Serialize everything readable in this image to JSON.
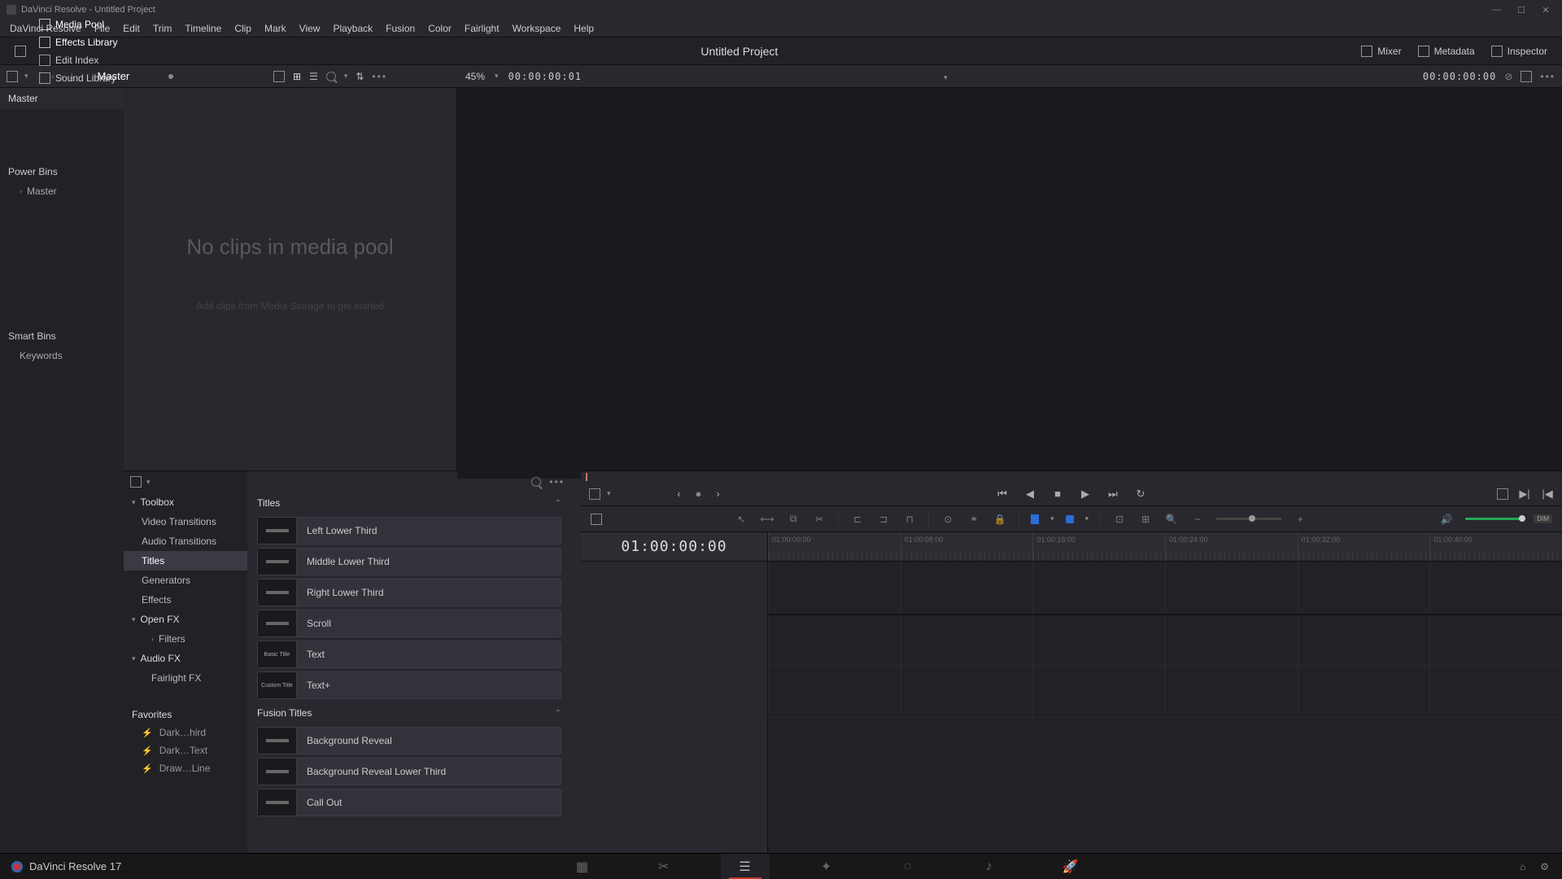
{
  "window": {
    "title": "DaVinci Resolve - Untitled Project"
  },
  "menu": [
    "DaVinci Resolve",
    "File",
    "Edit",
    "Trim",
    "Timeline",
    "Clip",
    "Mark",
    "View",
    "Playback",
    "Fusion",
    "Color",
    "Fairlight",
    "Workspace",
    "Help"
  ],
  "toolbar": {
    "left": [
      {
        "id": "media-pool",
        "label": "Media Pool"
      },
      {
        "id": "effects-library",
        "label": "Effects Library"
      },
      {
        "id": "edit-index",
        "label": "Edit Index"
      },
      {
        "id": "sound-library",
        "label": "Sound Library"
      }
    ],
    "title": "Untitled Project",
    "right": [
      {
        "id": "mixer",
        "label": "Mixer"
      },
      {
        "id": "metadata",
        "label": "Metadata"
      },
      {
        "id": "inspector",
        "label": "Inspector"
      }
    ]
  },
  "subbar": {
    "bin": "Master",
    "zoom": "45%",
    "timecodeLeft": "00:00:00:01",
    "timecodeRight": "00:00:00:00"
  },
  "bins": {
    "root": "Master",
    "powerLabel": "Power Bins",
    "powerItems": [
      "Master"
    ],
    "smartLabel": "Smart Bins",
    "smartItems": [
      "Keywords"
    ]
  },
  "mediaPool": {
    "emptyTitle": "No clips in media pool",
    "emptySub": "Add clips from Media Storage to get started"
  },
  "fxTree": {
    "toolbox": "Toolbox",
    "items": [
      "Video Transitions",
      "Audio Transitions",
      "Titles",
      "Generators",
      "Effects"
    ],
    "selected": "Titles",
    "openfx": "Open FX",
    "openfxItems": [
      "Filters"
    ],
    "audiofx": "Audio FX",
    "audiofxItems": [
      "Fairlight FX"
    ],
    "favorites": "Favorites",
    "favItems": [
      "Dark…hird",
      "Dark…Text",
      "Draw…Line"
    ]
  },
  "fxList": {
    "group1": "Titles",
    "items1": [
      {
        "label": "Left Lower Third",
        "thumb": "line"
      },
      {
        "label": "Middle Lower Third",
        "thumb": "line"
      },
      {
        "label": "Right Lower Third",
        "thumb": "line"
      },
      {
        "label": "Scroll",
        "thumb": "line"
      },
      {
        "label": "Text",
        "thumb": "Basic Title"
      },
      {
        "label": "Text+",
        "thumb": "Custom Title"
      }
    ],
    "group2": "Fusion Titles",
    "items2": [
      {
        "label": "Background Reveal",
        "thumb": "line"
      },
      {
        "label": "Background Reveal Lower Third",
        "thumb": "line"
      },
      {
        "label": "Call Out",
        "thumb": "line"
      }
    ]
  },
  "timeline": {
    "tc": "01:00:00:00",
    "ruler": [
      "01:00:00:00",
      "01:00:08:00",
      "01:00:16:00",
      "01:00:24:00",
      "01:00:32:00",
      "01:00:40:00"
    ],
    "dim": "DIM"
  },
  "bottom": {
    "app": "DaVinci Resolve 17",
    "pages": [
      "media",
      "cut",
      "edit",
      "fusion",
      "color",
      "fairlight",
      "deliver"
    ],
    "active": "edit"
  }
}
